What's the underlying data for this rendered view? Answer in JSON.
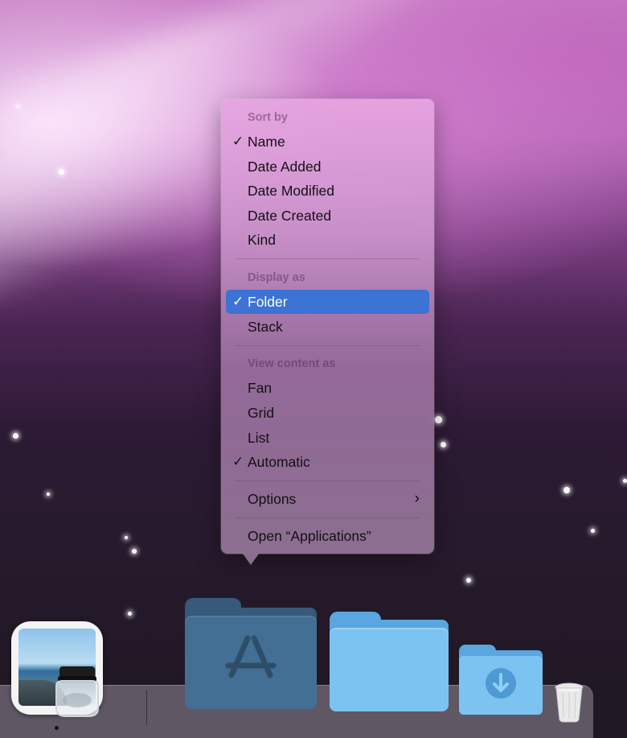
{
  "menu": {
    "sort_header": "Sort by",
    "sort_items": [
      {
        "label": "Name",
        "checked": true
      },
      {
        "label": "Date Added",
        "checked": false
      },
      {
        "label": "Date Modified",
        "checked": false
      },
      {
        "label": "Date Created",
        "checked": false
      },
      {
        "label": "Kind",
        "checked": false
      }
    ],
    "display_header": "Display as",
    "display_items": [
      {
        "label": "Folder",
        "checked": true,
        "selected": true
      },
      {
        "label": "Stack",
        "checked": false
      }
    ],
    "view_header": "View content as",
    "view_items": [
      {
        "label": "Fan",
        "checked": false
      },
      {
        "label": "Grid",
        "checked": false
      },
      {
        "label": "List",
        "checked": false
      },
      {
        "label": "Automatic",
        "checked": true
      }
    ],
    "options_label": "Options",
    "open_label": "Open “Applications”",
    "check_glyph": "✓",
    "chevron_glyph": "›"
  },
  "dock": {
    "apps": [
      {
        "icon": "preview-app-icon",
        "running": true
      },
      {
        "icon": "applications-folder-icon"
      },
      {
        "icon": "documents-folder-icon"
      },
      {
        "icon": "downloads-folder-icon"
      },
      {
        "icon": "trash-icon"
      }
    ]
  },
  "colors": {
    "selection": "#3d73d4",
    "folder_blue": "#7cc0f0",
    "folder_dark": "#3e6a8c"
  }
}
